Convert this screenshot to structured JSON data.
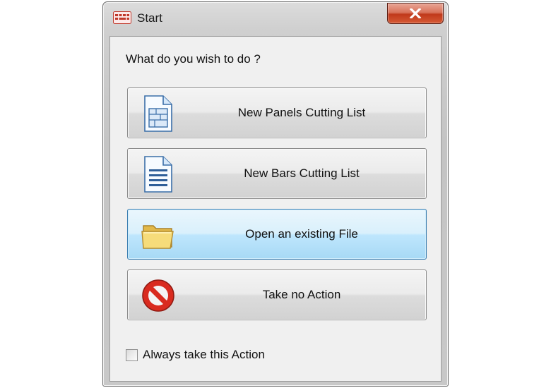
{
  "window": {
    "title": "Start",
    "close_label": "✕"
  },
  "prompt": "What do you wish to do ?",
  "actions": [
    {
      "label": "New Panels Cutting List",
      "icon": "panels-document-icon"
    },
    {
      "label": "New Bars Cutting List",
      "icon": "bars-document-icon"
    },
    {
      "label": "Open an existing File",
      "icon": "folder-icon"
    },
    {
      "label": "Take no Action",
      "icon": "no-entry-icon"
    }
  ],
  "always_checkbox": {
    "label": "Always take this Action",
    "checked": false
  },
  "colors": {
    "focus_border": "#3c7fb1",
    "close_red": "#c0391b",
    "no_entry_red": "#d92b1f",
    "folder_yellow": "#f3d46a"
  }
}
